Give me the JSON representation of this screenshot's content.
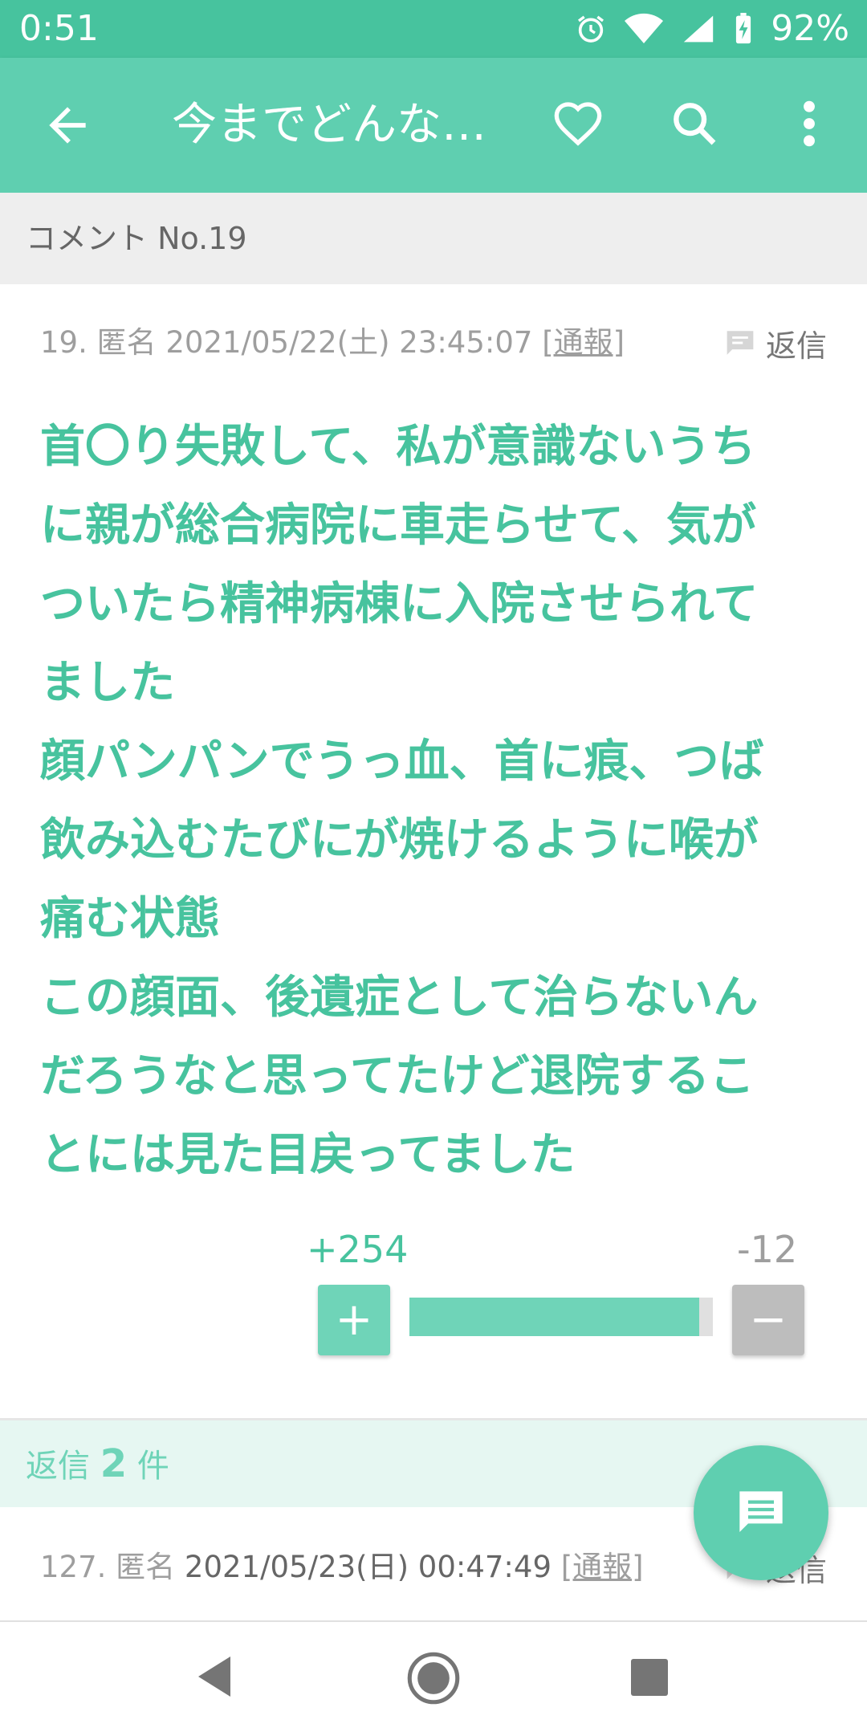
{
  "status_bar": {
    "time": "0:51",
    "battery_percent": "92%",
    "icons": [
      "alarm-icon",
      "wifi-icon",
      "signal-icon",
      "battery-charging-icon"
    ]
  },
  "app_bar": {
    "title": "今までどんな…",
    "icons": [
      "back-arrow-icon",
      "heart-icon",
      "search-icon",
      "more-vert-icon"
    ]
  },
  "section_header": {
    "label": "コメント No.19"
  },
  "comment": {
    "number": "19.",
    "author": "匿名",
    "datetime": "2021/05/22(土) 23:45:07",
    "report_label": "[通報]",
    "reply_label": "返信",
    "body_lines": [
      "首〇り失敗して、私が意識ないうち",
      "に親が総合病院に車走らせて、気が",
      "ついたら精神病棟に入院させられて",
      "ました",
      "顔パンパンでうっ血、首に痕、つば",
      "飲み込むたびにが焼けるように喉が",
      "痛む状態",
      "この顔面、後遺症として治らないん",
      "だろうなと思ってたけど退院するこ",
      "とには見た目戻ってました"
    ],
    "votes": {
      "plus_count": "+254",
      "minus_count": "-12",
      "plus_button": "+",
      "minus_button": "−",
      "plus_ratio": 0.955
    }
  },
  "replies": {
    "label_prefix": "返信",
    "count": "2",
    "label_suffix": "件"
  },
  "reply_comment": {
    "number": "127.",
    "author": "匿名",
    "datetime": "2021/05/23(日) 00:47:49",
    "report_label": "[通報]",
    "reply_label": "返信"
  },
  "colors": {
    "status_bar": "#47c39e",
    "app_bar": "#5fcfb0",
    "accent_text": "#47c39e",
    "plus_button": "#6fd4b8",
    "minus_button": "#bdbdbd",
    "replies_bar": "#e6f7f2"
  }
}
